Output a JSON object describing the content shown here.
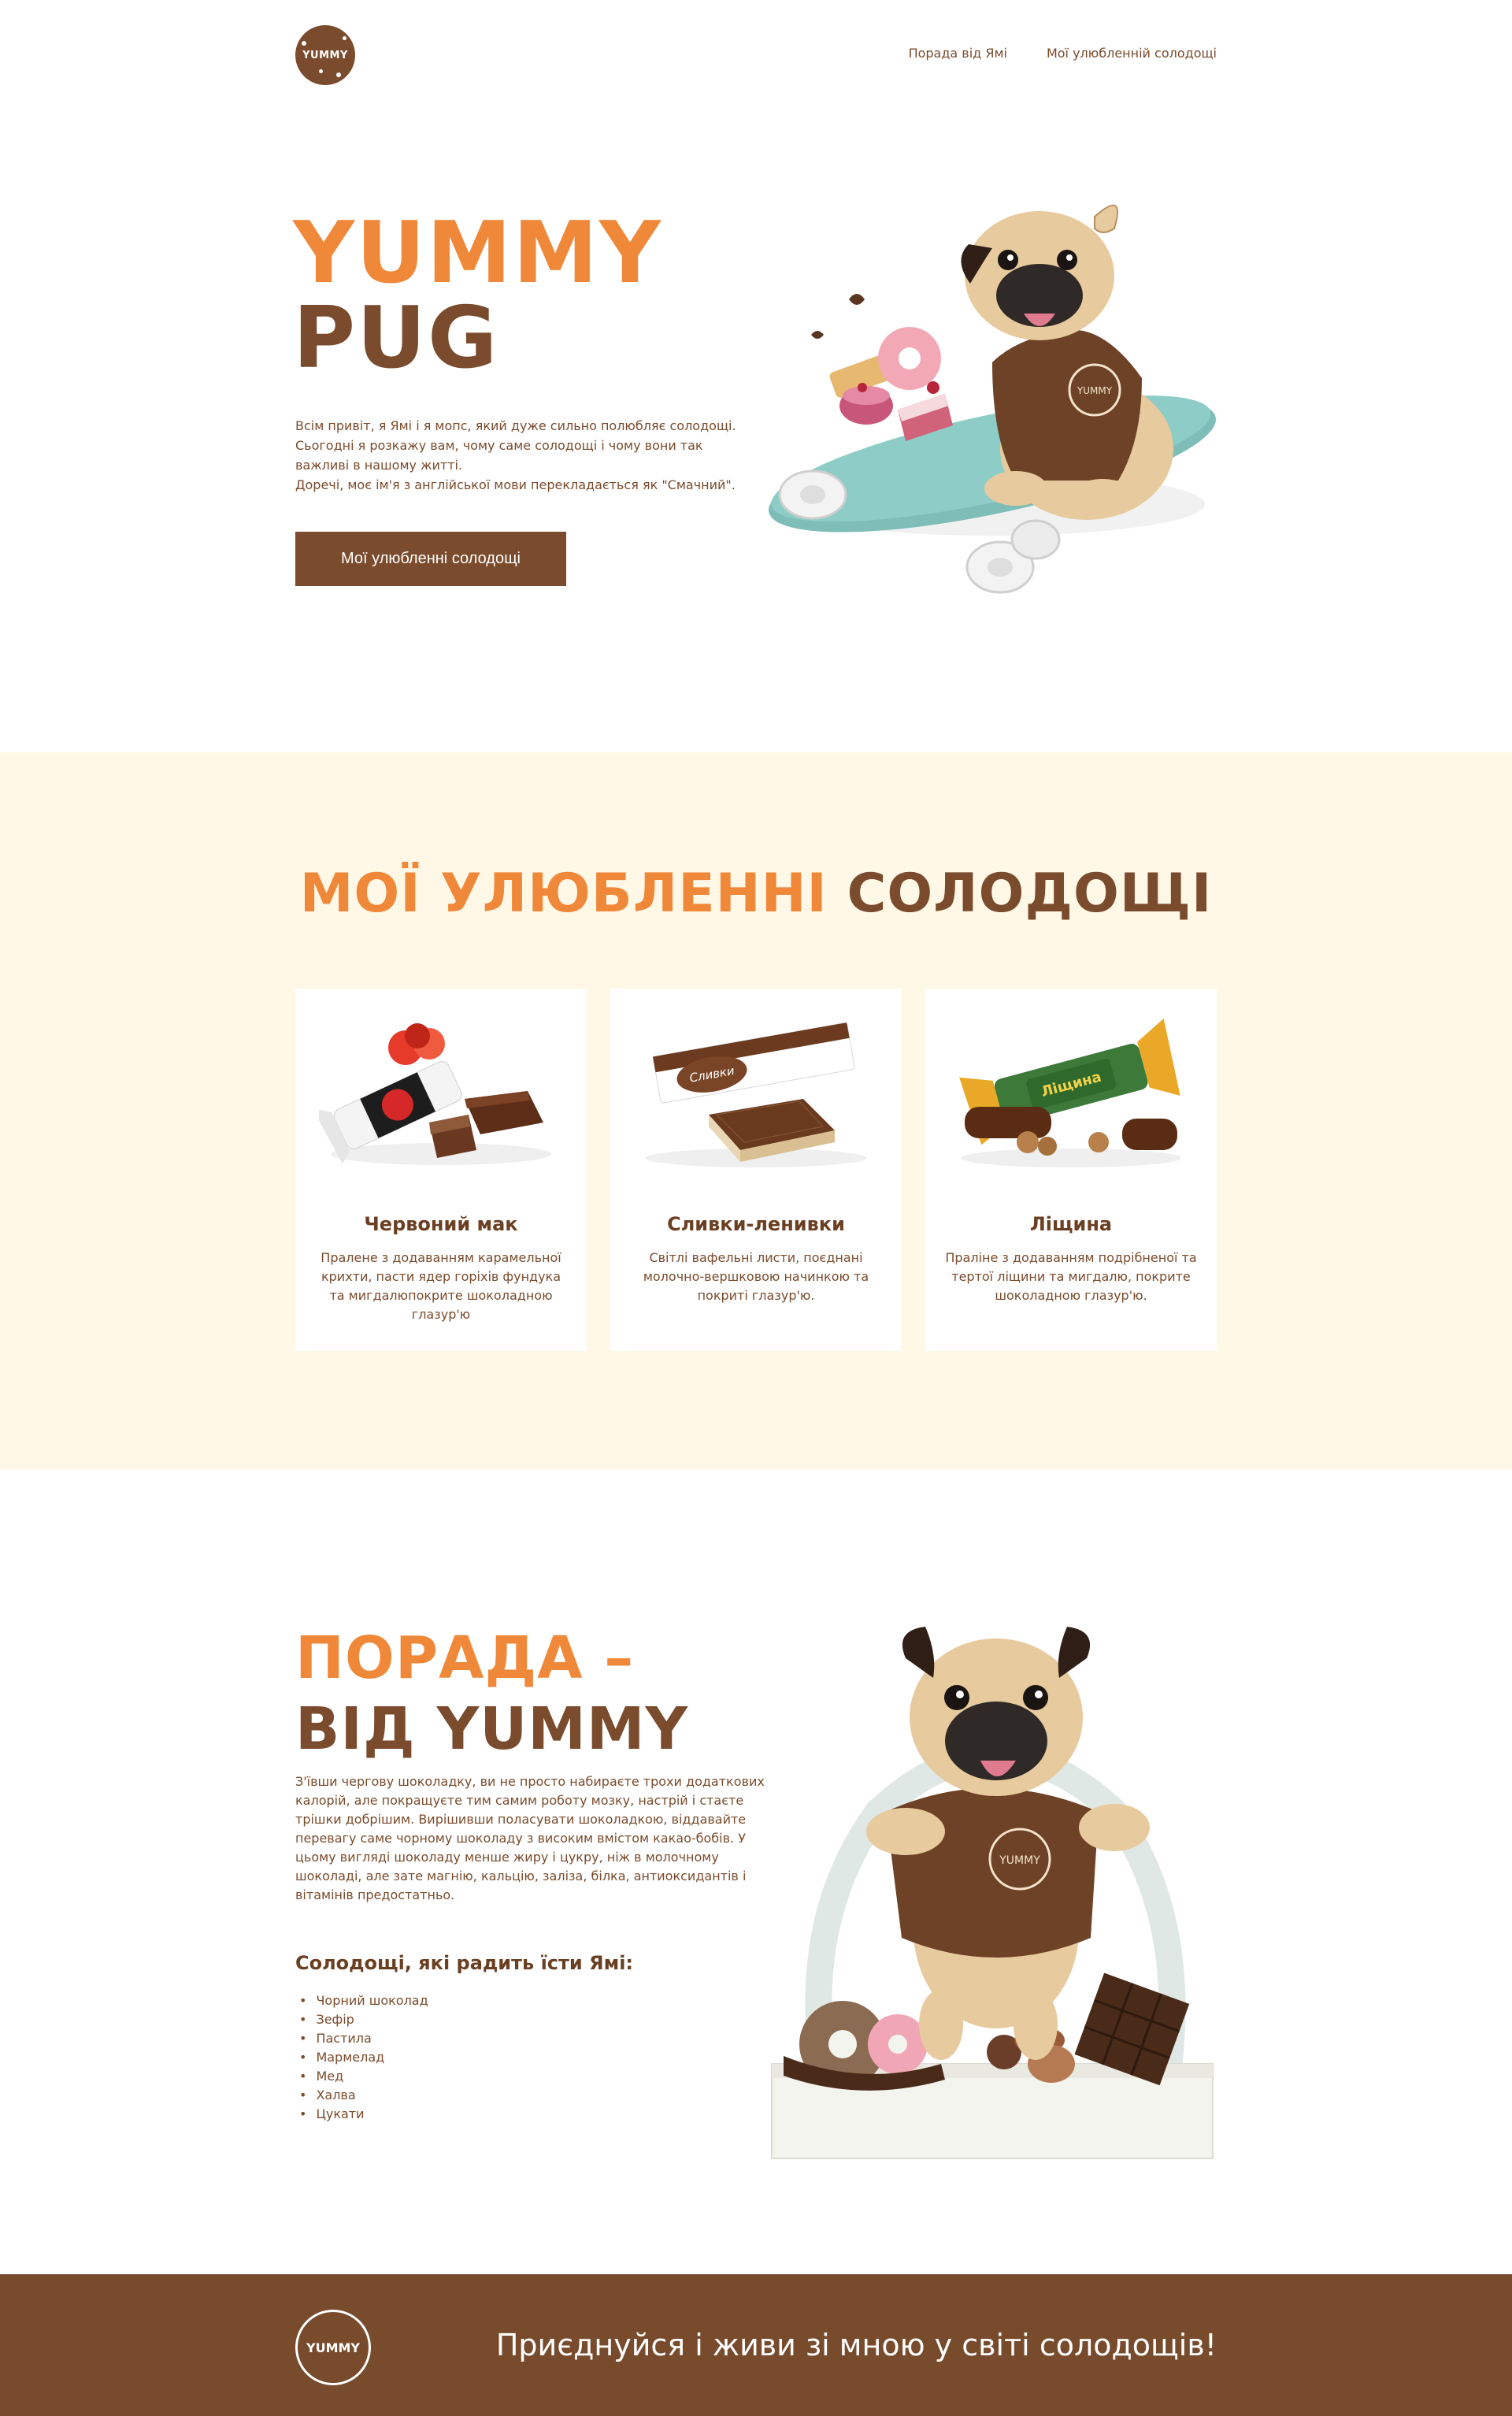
{
  "header": {
    "logo_text": "YUMMY",
    "nav": [
      "Порада від Ямі",
      "Мої улюбленній солодощі"
    ]
  },
  "hero": {
    "title_line1": "YUMMY",
    "title_line2": "PUG",
    "description_lines": [
      "Всім привіт, я Ямі і я мопс, який дуже сильно полюбляє солодощі.",
      "Сьогодні я розкажу вам, чому саме солодощі і чому вони так",
      "важливі в нашому житті.",
      "Доречі, моє ім'я з англійської мови перекладається як \"Смачний\"."
    ],
    "button": "Мої улюбленні солодощі"
  },
  "favorites": {
    "title_orange": "МОЇ УЛЮБЛЕННІ",
    "title_brown": "СОЛОДОЩІ",
    "cards": [
      {
        "name": "Червоний мак",
        "desc": "Пралене з додаванням карамельної крихти, пасти ядер горіхів фундука та мигдалюпокрите шоколадною глазур'ю"
      },
      {
        "name": "Сливки-ленивки",
        "desc": "Світлі вафельні листи, поєднані молочно-вершковою начинкою та покриті глазур'ю."
      },
      {
        "name": "Ліщина",
        "desc": "Праліне з додаванням подрібненої та тертої ліщини та мигдалю, покрите шоколадною глазур'ю."
      }
    ]
  },
  "advice": {
    "title_line1": "ПОРАДА –",
    "title_line2": "ВІД YUMMY",
    "description": "З'ївши чергову шоколадку, ви не просто набираєте трохи додаткових калорій, але покращуєте тим самим роботу мозку, настрій і стаєте трішки добрішим. Вирішивши поласувати шоколадкою, віддавайте перевагу саме чорному шоколаду з високим вмістом какао-бобів. У цьому вигляді шоколаду менше жиру і цукру, ніж в молочному шоколаді, але зате магнію, кальцію, заліза, білка, антиоксидантів і вітамінів предостатньо.",
    "subtitle": "Солодощі, які радить їсти Ямі:",
    "list": [
      "Чорний шоколад",
      "Зефір",
      "Пастила",
      "Мармелад",
      "Мед",
      "Халва",
      "Цукати"
    ]
  },
  "footer": {
    "logo_text": "YUMMY",
    "slogan": "Приєднуйся і живи зі мною у світі солодощів!"
  },
  "colors": {
    "brown": "#7a4b2c",
    "orange": "#f0883a",
    "cream": "#fff8e6",
    "footer": "#784b2d"
  }
}
